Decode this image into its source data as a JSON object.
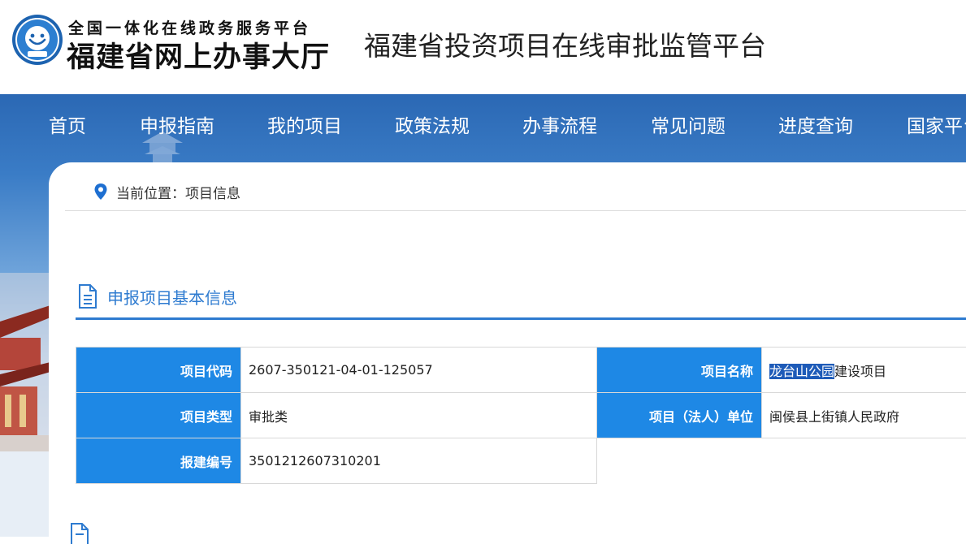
{
  "header": {
    "logo_line1": "全国一体化在线政务服务平台",
    "logo_line2": "福建省网上办事大厅",
    "site_title": "福建省投资项目在线审批监管平台",
    "logo_icon": "smiley-emblem-icon"
  },
  "nav": {
    "items": [
      {
        "label": "首页"
      },
      {
        "label": "申报指南"
      },
      {
        "label": "我的项目"
      },
      {
        "label": "政策法规"
      },
      {
        "label": "办事流程"
      },
      {
        "label": "常见问题"
      },
      {
        "label": "进度查询"
      },
      {
        "label": "国家平台"
      }
    ]
  },
  "breadcrumb": {
    "icon": "location-pin-icon",
    "text": "当前位置：项目信息"
  },
  "section": {
    "icon": "document-icon",
    "title": "申报项目基本信息"
  },
  "info": {
    "project_code_label": "项目代码",
    "project_code": "2607-350121-04-01-125057",
    "project_name_label": "项目名称",
    "project_name_selected": "龙台山公园",
    "project_name_rest": "建设项目",
    "project_type_label": "项目类型",
    "project_type": "审批类",
    "unit_label": "项目（法人）单位",
    "unit": "闽侯县上街镇人民政府",
    "report_no_label": "报建编号",
    "report_no": "3501212607310201"
  },
  "colors": {
    "nav_blue": "#2b68b4",
    "label_blue": "#1e88e5",
    "accent_blue": "#2e7bd0"
  }
}
